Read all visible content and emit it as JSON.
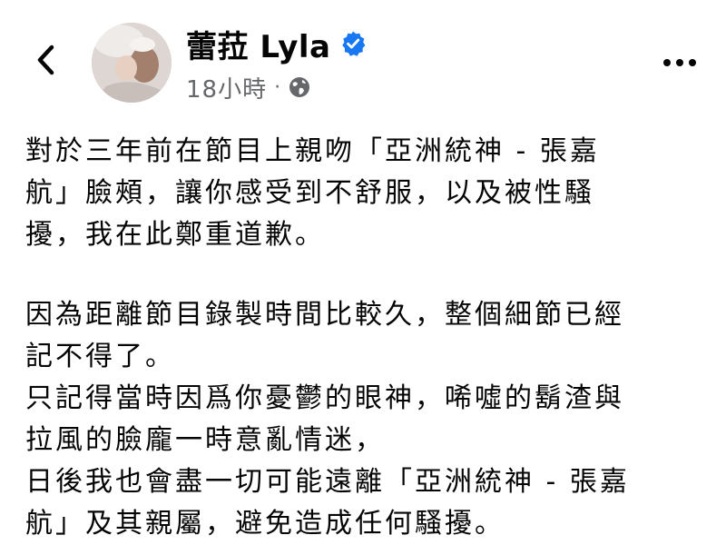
{
  "post": {
    "author": "蕾菈 Lyla",
    "timestamp": "18小時",
    "separator": "·",
    "paragraphs": [
      [
        "對於三年前在節目上親吻「亞洲統神 - 張嘉",
        "航」臉頰，讓你感受到不舒服，以及被性騷",
        "擾，我在此鄭重道歉。"
      ],
      [
        "因為距離節目錄製時間比較久，整個細節已經",
        "記不得了。",
        "只記得當時因爲你憂鬱的眼神，唏噓的鬍渣與",
        "拉風的臉龐一時意亂情迷，",
        "日後我也會盡一切可能遠離「亞洲統神 - 張嘉",
        "航」及其親屬，避免造成任何騷擾。"
      ]
    ]
  },
  "icons": {
    "back": "chevron-left-icon",
    "verified": "verified-badge-icon",
    "audience": "globe-icon",
    "more": "more-horizontal-icon"
  },
  "colors": {
    "verified_blue": "#1877f2",
    "meta_gray": "#65676b",
    "text": "#050505"
  }
}
